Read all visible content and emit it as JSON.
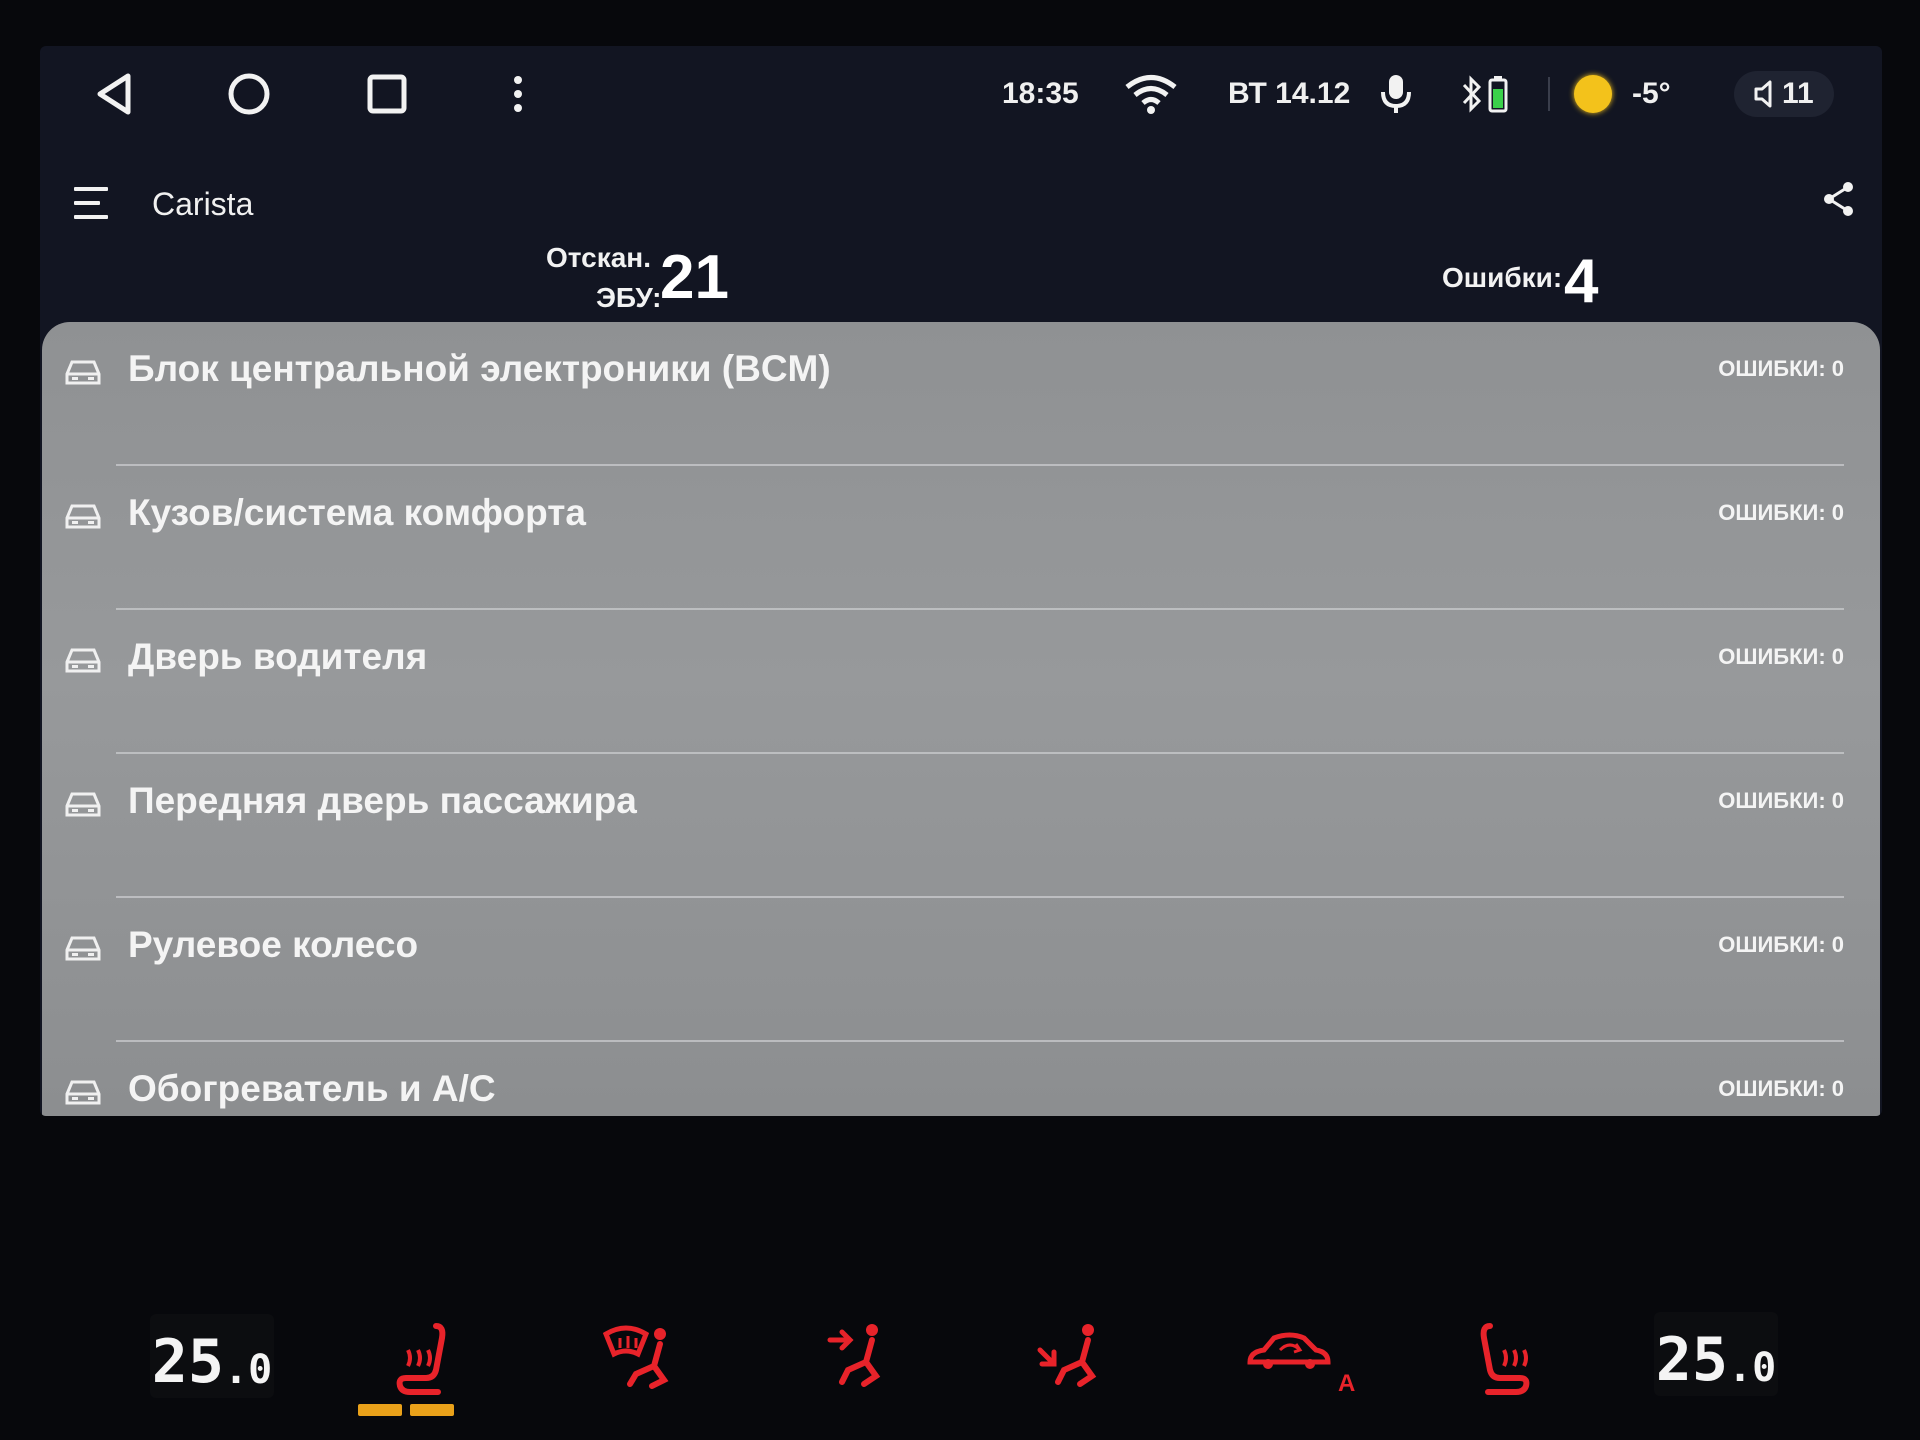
{
  "status_bar": {
    "time": "18:35",
    "date": "ВТ 14.12",
    "temperature": "-5°",
    "volume": "11",
    "icons": [
      "back-icon",
      "home-icon",
      "recents-icon",
      "more-vert-icon",
      "wifi-icon",
      "mic-icon",
      "bluetooth-icon",
      "battery-icon",
      "sun-icon",
      "volume-icon"
    ]
  },
  "app_bar": {
    "title": "Carista",
    "icons": [
      "menu-icon",
      "share-icon"
    ]
  },
  "stats": {
    "scanned_label_line1": "Отскан.",
    "scanned_label_line2": "ЭБУ:",
    "scanned_value": "21",
    "errors_label": "Ошибки:",
    "errors_value": "4"
  },
  "ecu_list": [
    {
      "name": "Блок центральной электроники (BCM)",
      "errors": "ОШИБКИ: 0"
    },
    {
      "name": "Кузов/система комфорта",
      "errors": "ОШИБКИ: 0"
    },
    {
      "name": "Дверь водителя",
      "errors": "ОШИБКИ: 0"
    },
    {
      "name": "Передняя дверь пассажира",
      "errors": "ОШИБКИ: 0"
    },
    {
      "name": "Рулевое колесо",
      "errors": "ОШИБКИ: 0"
    },
    {
      "name": "Обогреватель и A/C",
      "errors": "ОШИБКИ: 0"
    }
  ],
  "climate": {
    "left_temp_int": "25",
    "left_temp_dec": ".0",
    "right_temp_int": "25",
    "right_temp_dec": ".0",
    "recirc_auto": "A",
    "accent_color": "#e8232a",
    "heat_indicator_color": "#e9a11a"
  },
  "colors": {
    "screen_bg": "#121522",
    "list_bg": "#939597",
    "text": "#f4f4f4"
  }
}
